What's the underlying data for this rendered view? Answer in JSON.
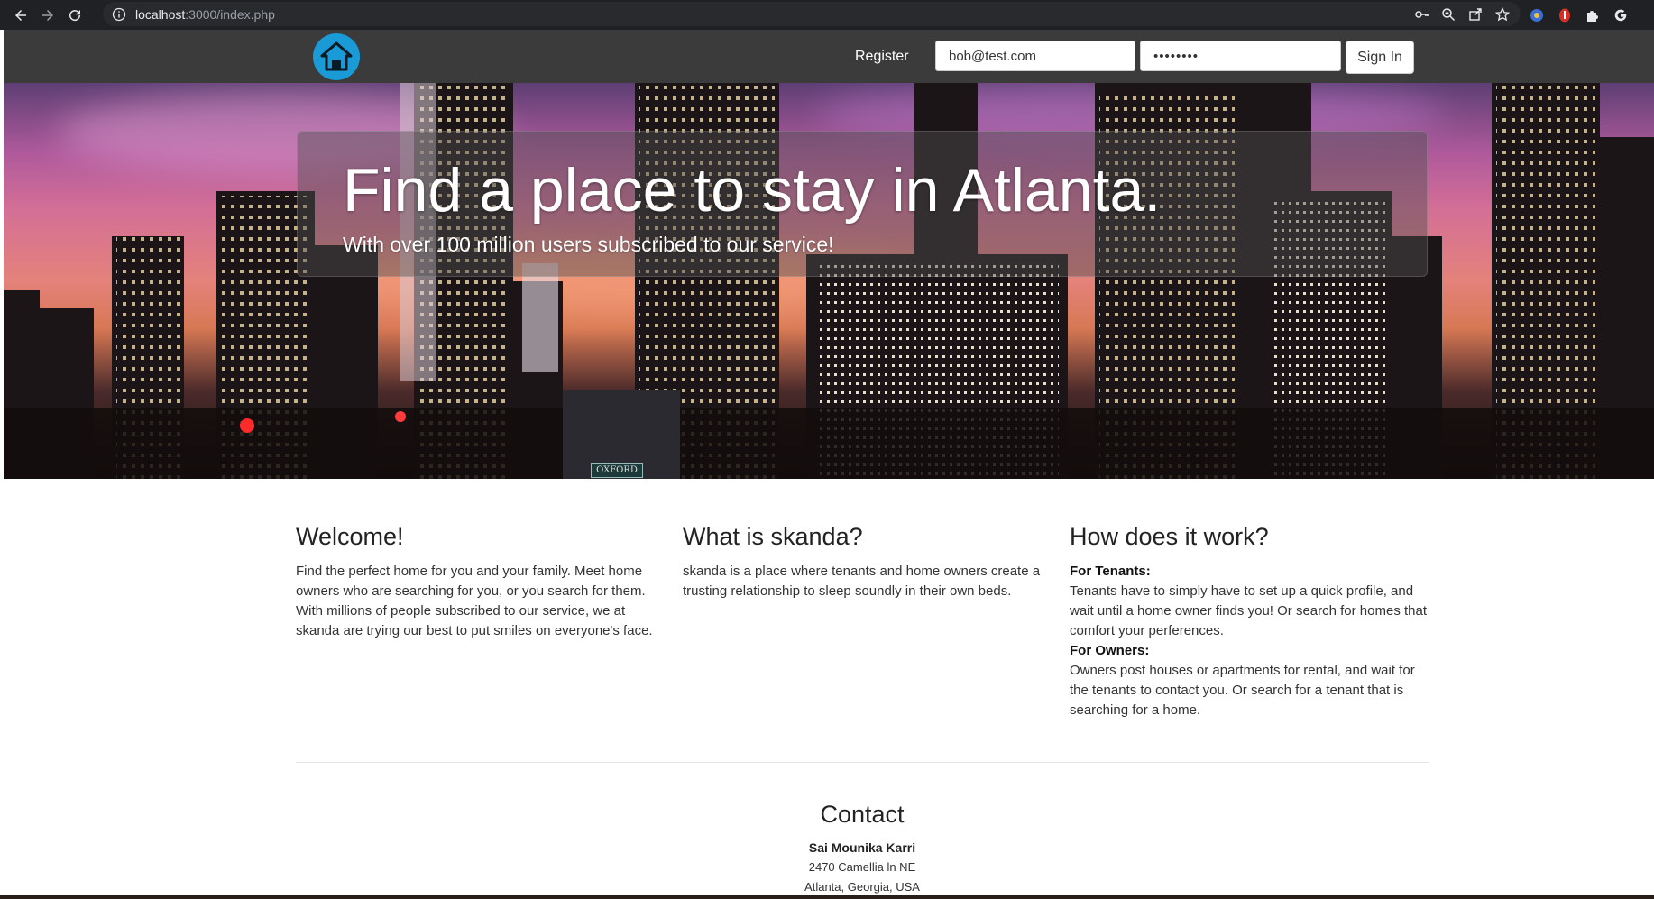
{
  "browser": {
    "url_host": "localhost",
    "url_rest": ":3000/index.php",
    "icons": [
      "back-icon",
      "forward-icon",
      "reload-icon",
      "info-icon",
      "key-icon",
      "zoom-icon",
      "share-icon",
      "star-icon",
      "extension-a-icon",
      "extension-b-icon",
      "puzzle-icon",
      "google-icon"
    ]
  },
  "nav": {
    "register": "Register",
    "email_value": "bob@test.com",
    "password_value": "••••••••",
    "signin": "Sign In"
  },
  "hero": {
    "title": "Find a place to stay in Atlanta.",
    "subtitle": "With over 100 million users subscribed to our service!",
    "street_sign": "OXFORD"
  },
  "columns": {
    "welcome": {
      "heading": "Welcome!",
      "body": "Find the perfect home for you and your family. Meet home owners who are searching for you, or you search for them. With millions of people subscribed to our service, we at skanda are trying our best to put smiles on everyone's face."
    },
    "about": {
      "heading": "What is skanda?",
      "body": "skanda is a place where tenants and home owners create a trusting relationship to sleep soundly in their own beds."
    },
    "how": {
      "heading": "How does it work?",
      "tenants_label": "For Tenants:",
      "tenants_body": "Tenants have to simply have to set up a quick profile, and wait until a home owner finds you! Or search for homes that comfort your perferences.",
      "owners_label": "For Owners:",
      "owners_body": "Owners post houses or apartments for rental, and wait for the tenants to contact you. Or search for a tenant that is searching for a home."
    }
  },
  "contact": {
    "heading": "Contact",
    "name": "Sai Mounika Karri",
    "address1": "2470 Camellia ln NE",
    "address2": "Atlanta, Georgia, USA"
  },
  "colors": {
    "chrome_bg": "#202124",
    "navbar_bg": "#3b3b3b",
    "logo_blue": "#1a9ad6"
  }
}
